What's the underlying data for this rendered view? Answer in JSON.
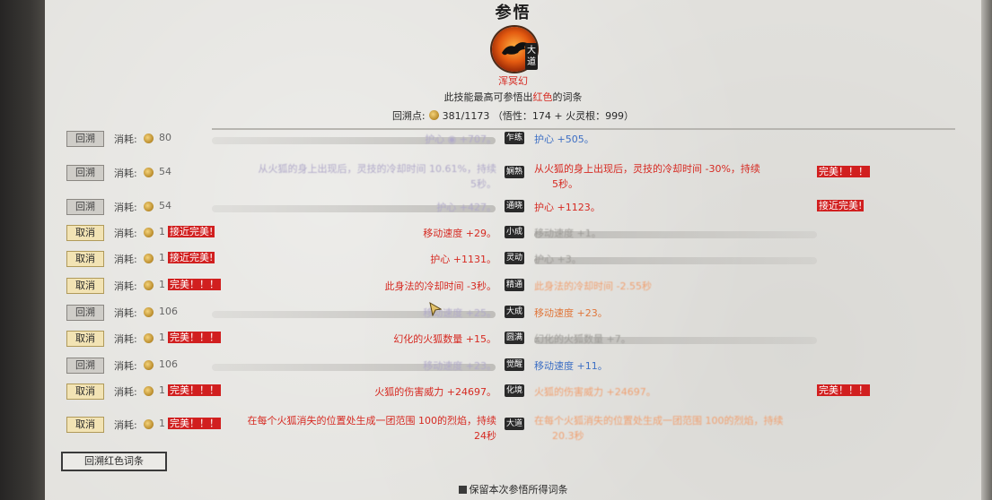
{
  "title": "参悟",
  "skill": {
    "name": "浑冥幻",
    "badge": "大道"
  },
  "hint": {
    "prefix": "此技能最高可参悟出",
    "highlight": "红色",
    "suffix": "的词条"
  },
  "points": {
    "label": "回溯点:",
    "value": "381/1173",
    "detail": "（悟性：174 + 火灵根：999）"
  },
  "cost_label": "消耗:",
  "rows": [
    {
      "button": "回溯",
      "button_type": "back",
      "cost": "80",
      "tag": "",
      "left": "护心 ◉ +707。",
      "left_faded": true,
      "pill": "乍练",
      "right": "护心 +505。",
      "right_style": "blue",
      "right_tag": ""
    },
    {
      "button": "回溯",
      "button_type": "back",
      "cost": "54",
      "tag": "",
      "left": "从火狐的身上出现后，灵技的冷却时间 10.61%，持续",
      "left2": "5秒。",
      "left_faded": true,
      "pill": "娴熟",
      "right": "从火狐的身上出现后，灵技的冷却时间 -30%，持续",
      "right2": "5秒。",
      "right_style": "red",
      "right_tag": "完美！！！"
    },
    {
      "button": "回溯",
      "button_type": "back",
      "cost": "54",
      "tag": "",
      "left": "护心 +427。",
      "left_faded": true,
      "pill": "通晓",
      "right": "护心 +1123。",
      "right_style": "red",
      "right_tag": "接近完美!"
    },
    {
      "button": "取消",
      "button_type": "cancel",
      "cost": "1",
      "tag": "接近完美!",
      "left": "移动速度 +29。",
      "left_faded": false,
      "pill": "小成",
      "right": "移动速度 +1。",
      "right_style": "faded",
      "right_tag": ""
    },
    {
      "button": "取消",
      "button_type": "cancel",
      "cost": "1",
      "tag": "接近完美!",
      "left": "护心 +1131。",
      "left_faded": false,
      "pill": "灵动",
      "right": "护心 +3。",
      "right_style": "faded",
      "right_tag": ""
    },
    {
      "button": "取消",
      "button_type": "cancel",
      "cost": "1",
      "tag": "完美！！！",
      "left": "此身法的冷却时间 -3秒。",
      "left_faded": false,
      "pill": "精通",
      "right": "此身法的冷却时间 -2.55秒",
      "right_style": "orange-faded",
      "right_tag": ""
    },
    {
      "button": "回溯",
      "button_type": "back",
      "cost": "106",
      "tag": "",
      "left": "移动速度 +25。",
      "left_faded": true,
      "pill": "大成",
      "right": "移动速度 +23。",
      "right_style": "orange",
      "right_tag": ""
    },
    {
      "button": "取消",
      "button_type": "cancel",
      "cost": "1",
      "tag": "完美！！！",
      "left": "幻化的火狐数量 +15。",
      "left_faded": false,
      "pill": "圆满",
      "right": "幻化的火狐数量 +7。",
      "right_style": "faded",
      "right_tag": ""
    },
    {
      "button": "回溯",
      "button_type": "back",
      "cost": "106",
      "tag": "",
      "left": "移动速度 +23。",
      "left_faded": true,
      "pill": "觉醒",
      "right": "移动速度 +11。",
      "right_style": "blue",
      "right_tag": ""
    },
    {
      "button": "取消",
      "button_type": "cancel",
      "cost": "1",
      "tag": "完美！！！",
      "left": "火狐的伤害威力 +24697。",
      "left_faded": false,
      "pill": "化境",
      "right": "火狐的伤害威力 +24697。",
      "right_style": "orange-faded",
      "right_tag": "完美！！！"
    },
    {
      "button": "取消",
      "button_type": "cancel",
      "cost": "1",
      "tag": "完美！！！",
      "left": "在每个火狐消失的位置处生成一团范围 100的烈焰，持续",
      "left2": "24秒",
      "left_faded": false,
      "pill": "大道",
      "right": "在每个火狐消失的位置处生成一团范围 100的烈焰，持续",
      "right2": "20.3秒",
      "right_style": "orange-faded",
      "right_tag": ""
    }
  ],
  "bottom_button": "回溯红色词条",
  "keep_label": "保留本次参悟所得词条"
}
